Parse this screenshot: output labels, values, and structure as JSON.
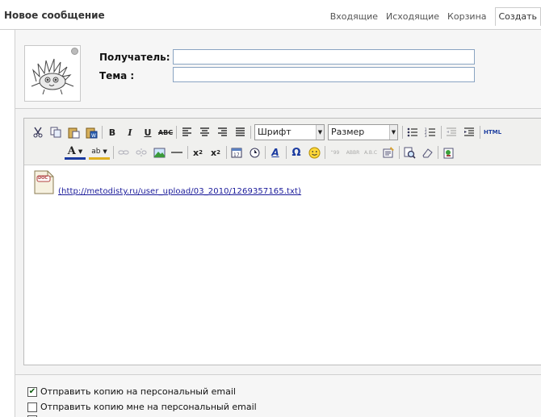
{
  "header": {
    "title": "Новое сообщение",
    "tabs": [
      {
        "label": "Входящие"
      },
      {
        "label": "Исходящие"
      },
      {
        "label": "Корзина"
      },
      {
        "label": "Создать",
        "active": true
      }
    ]
  },
  "form": {
    "recipient_label": "Получатель:",
    "recipient_value": "",
    "subject_label": "Тема :",
    "subject_value": ""
  },
  "toolbar": {
    "font_select": "Шрифт",
    "size_select": "Размер",
    "html_label": "HTML",
    "icons_row1": [
      "cut-icon",
      "copy-icon",
      "paste-icon",
      "paste-word-icon",
      "bold-icon",
      "italic-icon",
      "underline-icon",
      "strikethrough-icon",
      "align-left-icon",
      "align-center-icon",
      "align-right-icon",
      "justify-icon",
      "bullet-list-icon",
      "numbered-list-icon",
      "outdent-icon",
      "indent-icon",
      "html-source-icon"
    ],
    "icons_row2": [
      "font-color-icon",
      "highlight-color-icon",
      "link-icon",
      "unlink-icon",
      "image-icon",
      "horizontal-rule-icon",
      "subscript-icon",
      "superscript-icon",
      "date-icon",
      "time-icon",
      "style-icon",
      "special-char-icon",
      "emoticon-icon",
      "quote-icon",
      "abbr-icon",
      "acronym-icon",
      "insert-template-icon",
      "search-icon",
      "cleanup-icon",
      "preview-icon"
    ]
  },
  "editor": {
    "attachment_link": "(http://metodisty.ru/user_upload/03_2010/1269357165.txt)",
    "doc_badge": "DOC"
  },
  "options": [
    {
      "label": "Отправить копию на персональный email",
      "checked": true
    },
    {
      "label": "Отправить копию мне на персональный email",
      "checked": false
    }
  ]
}
